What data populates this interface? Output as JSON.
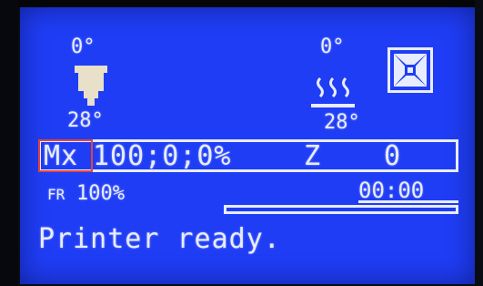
{
  "hotend": {
    "target_temp": "0°",
    "current_temp": "28°"
  },
  "bed": {
    "target_temp": "0°",
    "current_temp": "28°"
  },
  "status_line": {
    "mode_label": "Mx",
    "values": "100;0;0%",
    "axis_label": "Z",
    "axis_value": "0"
  },
  "feedrate": {
    "icon_text": "FR",
    "value": "100%"
  },
  "print_time": "00:00",
  "progress_fraction": 0,
  "message": "Printer ready.",
  "icons": [
    "hotend-icon",
    "bed-heat-icon",
    "fan-icon"
  ],
  "colors": {
    "lcd_background": "#1f3df5",
    "pixel_foreground": "#e8ecff",
    "highlight_box": "#e0453a"
  }
}
